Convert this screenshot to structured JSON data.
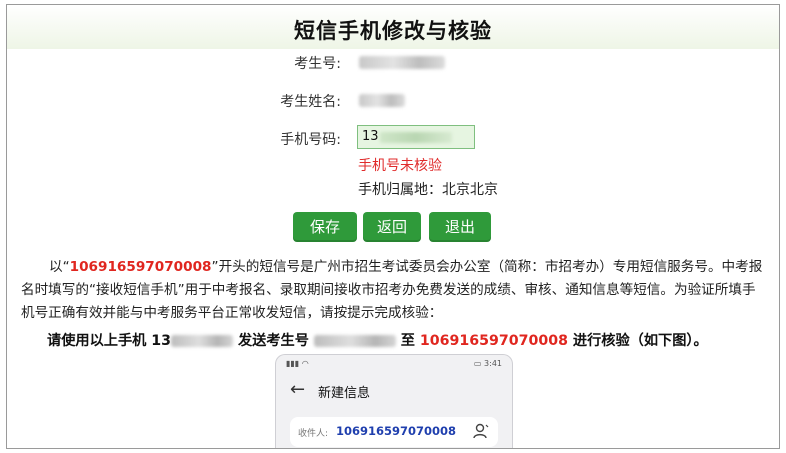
{
  "page": {
    "title": "短信手机修改与核验"
  },
  "form": {
    "exam_no_label": "考生号:",
    "name_label": "考生姓名:",
    "phone_label": "手机号码:",
    "phone_visible_prefix": "13",
    "phone_status": "手机号未核验",
    "location": "手机归属地：北京北京"
  },
  "buttons": {
    "save": "保存",
    "back": "返回",
    "exit": "退出"
  },
  "notice": {
    "p_start": "以“",
    "sms_number": "106916597070008",
    "p_rest": "”开头的短信号是广州市招生考试委员会办公室（简称：市招考办）专用短信服务号。中考报名时填写的“接收短信手机”用于中考报名、录取期间接收市招考办免费发送的成绩、审核、通知信息等短信。为验证所填手机号正确有效并能与中考服务平台正常收发短信，请按提示完成核验："
  },
  "instruction": {
    "part1": "请使用以上手机 13",
    "part2": " 发送考生号 ",
    "part3": " 至 ",
    "number": "106916597070008",
    "part4": " 进行核验（如下图）。"
  },
  "phone_screenshot": {
    "status_time": "3:41",
    "screen_title": "新建信息",
    "recipient_label": "收件人:",
    "recipient_number": "106916597070008",
    "icons": {
      "back": "arrow-left-icon",
      "contact": "person-icon"
    }
  },
  "colors": {
    "button_green": "#2f9a3a",
    "warning_red": "#e02b2b",
    "number_red": "#e0261f",
    "recipient_blue": "#1f3fae"
  }
}
